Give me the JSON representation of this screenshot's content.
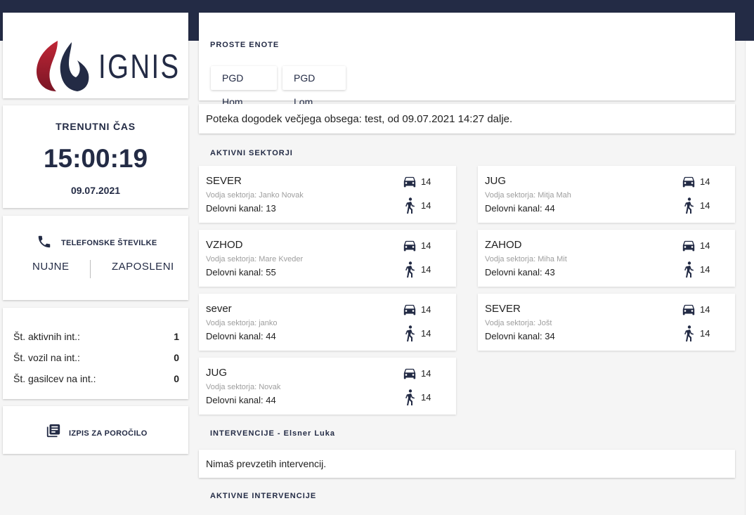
{
  "app": {
    "logo_text": "IGNIS"
  },
  "sidebar": {
    "time": {
      "label": "TRENUTNI ČAS",
      "value": "15:00:19",
      "date": "09.07.2021"
    },
    "phones": {
      "label": "TELEFONSKE ŠTEVILKE",
      "nujne": "NUJNE",
      "zaposleni": "ZAPOSLENI"
    },
    "stats": [
      {
        "label": "Št. aktivnih int.:",
        "value": "1"
      },
      {
        "label": "Št. vozil na int.:",
        "value": "0"
      },
      {
        "label": "Št. gasilcev na int.:",
        "value": "0"
      }
    ],
    "report": {
      "label": "IZPIS ZA POROČILO"
    }
  },
  "main": {
    "free_units": {
      "title": "PROSTE ENOTE",
      "units": [
        "PGD Hom",
        "PGD Lom"
      ]
    },
    "event_text": "Poteka dogodek večjega obsega: test, od 09.07.2021 14:27 dalje.",
    "sectors_title": "AKTIVNI SEKTORJI",
    "sectors": [
      {
        "name": "SEVER",
        "leader": "Vodja sektorja: Janko Novak",
        "channel": "Delovni kanal: 13",
        "vehicles": "14",
        "firefighters": "14"
      },
      {
        "name": "JUG",
        "leader": "Vodja sektorja: Mitja Mah",
        "channel": "Delovni kanal: 44",
        "vehicles": "14",
        "firefighters": "14"
      },
      {
        "name": "VZHOD",
        "leader": "Vodja sektorja: Mare Kveder",
        "channel": "Delovni kanal: 55",
        "vehicles": "14",
        "firefighters": "14"
      },
      {
        "name": "ZAHOD",
        "leader": "Vodja sektorja: Miha Mit",
        "channel": "Delovni kanal: 43",
        "vehicles": "14",
        "firefighters": "14"
      },
      {
        "name": "sever",
        "leader": "Vodja sektorja: janko",
        "channel": "Delovni kanal: 44",
        "vehicles": "14",
        "firefighters": "14"
      },
      {
        "name": "SEVER",
        "leader": "Vodja sektorja: Jošt",
        "channel": "Delovni kanal: 34",
        "vehicles": "14",
        "firefighters": "14"
      },
      {
        "name": "JUG",
        "leader": "Vodja sektorja: Novak",
        "channel": "Delovni kanal: 44",
        "vehicles": "14",
        "firefighters": "14"
      }
    ],
    "interventions": {
      "title": "INTERVENCIJE - Elsner Luka",
      "empty_text": "Nimaš prevzetih intervencij."
    },
    "active_interventions_title": "AKTIVNE INTERVENCIJE"
  },
  "colors": {
    "navy": "#232b45",
    "brand_red": "#8b1e2d"
  }
}
